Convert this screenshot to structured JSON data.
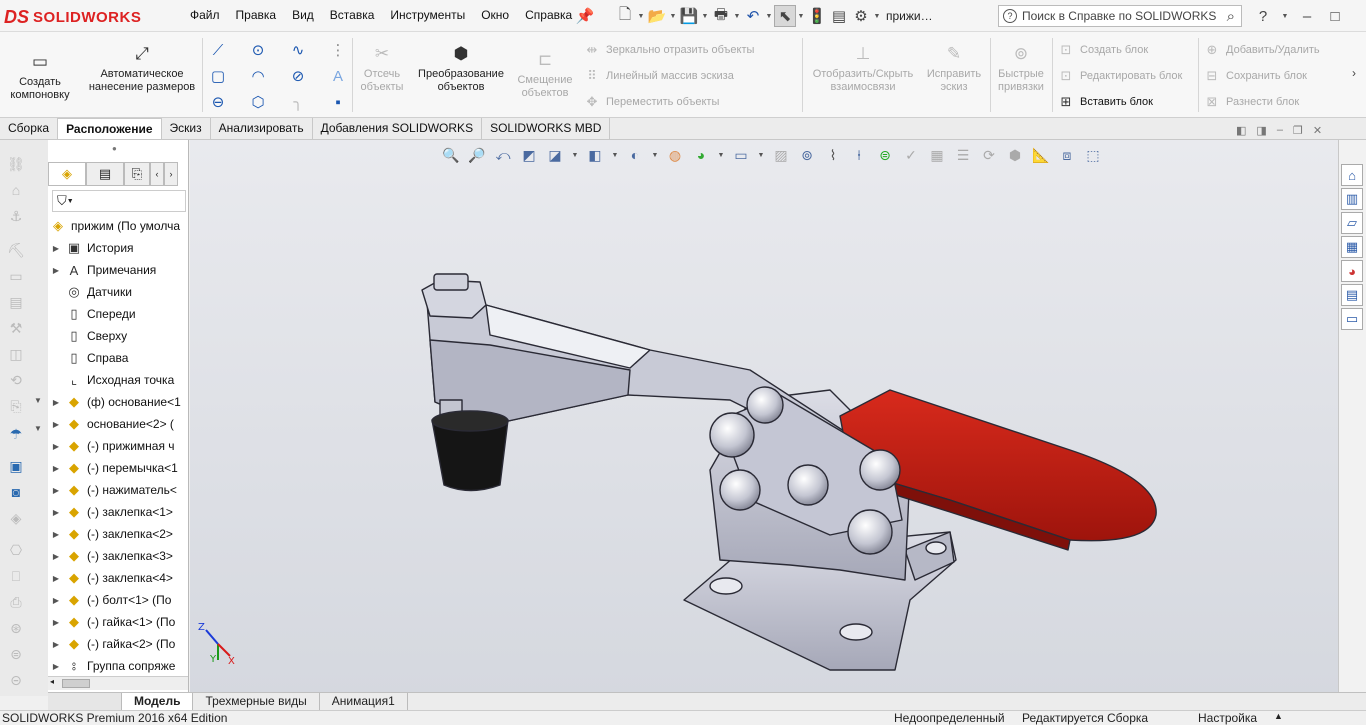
{
  "app": {
    "logo_ds": "DS",
    "logo_text": "SOLIDWORKS",
    "doc_name": "прижи…",
    "window_title_controls": [
      "?",
      "–",
      "□"
    ]
  },
  "menu": [
    "Файл",
    "Правка",
    "Вид",
    "Вставка",
    "Инструменты",
    "Окно",
    "Справка"
  ],
  "search": {
    "placeholder": "Поиск в Справке по SOLIDWORKS"
  },
  "ribbon": {
    "create_layout": "Создать компоновку",
    "auto_dim": "Автоматическое нанесение размеров",
    "trim": "Отсечь объекты",
    "convert": "Преобразование объектов",
    "offset": "Смещение объектов",
    "mirror": "Зеркально отразить объекты",
    "linear_pattern": "Линейный массив эскиза",
    "move": "Переместить объекты",
    "show_hide_rel": "Отобразить/Скрыть взаимосвязи",
    "repair": "Исправить эскиз",
    "quick_snaps": "Быстрые привязки",
    "create_block": "Создать блок",
    "edit_block": "Редактировать блок",
    "insert_block": "Вставить блок",
    "add_remove": "Добавить/Удалить",
    "save_block": "Сохранить блок",
    "explode_block": "Разнести блок"
  },
  "tabs": [
    "Сборка",
    "Расположение",
    "Эскиз",
    "Анализировать",
    "Добавления SOLIDWORKS",
    "SOLIDWORKS MBD"
  ],
  "active_tab": "Расположение",
  "tree": {
    "root": "прижим  (По умолча",
    "items": [
      {
        "label": "История",
        "icon": "history-icon",
        "exp": true
      },
      {
        "label": "Примечания",
        "icon": "annotations-icon",
        "exp": true
      },
      {
        "label": "Датчики",
        "icon": "sensors-icon",
        "exp": false
      },
      {
        "label": "Спереди",
        "icon": "plane-icon",
        "exp": false
      },
      {
        "label": "Сверху",
        "icon": "plane-icon",
        "exp": false
      },
      {
        "label": "Справа",
        "icon": "plane-icon",
        "exp": false
      },
      {
        "label": "Исходная точка",
        "icon": "origin-icon",
        "exp": false
      },
      {
        "label": "(ф) основание<1",
        "icon": "part-icon",
        "exp": true
      },
      {
        "label": "основание<2> (",
        "icon": "part-icon",
        "exp": true
      },
      {
        "label": "(-) прижимная ч",
        "icon": "part-icon",
        "exp": true
      },
      {
        "label": "(-) перемычка<1",
        "icon": "part-icon",
        "exp": true
      },
      {
        "label": "(-) нажиматель<",
        "icon": "part-icon",
        "exp": true
      },
      {
        "label": "(-) заклепка<1>",
        "icon": "part-icon",
        "exp": true
      },
      {
        "label": "(-) заклепка<2>",
        "icon": "part-icon",
        "exp": true
      },
      {
        "label": "(-) заклепка<3>",
        "icon": "part-icon",
        "exp": true
      },
      {
        "label": "(-) заклепка<4>",
        "icon": "part-icon",
        "exp": true
      },
      {
        "label": "(-) болт<1> (По",
        "icon": "part-icon",
        "exp": true
      },
      {
        "label": "(-) гайка<1> (По",
        "icon": "part-icon",
        "exp": true
      },
      {
        "label": "(-) гайка<2> (По",
        "icon": "part-icon",
        "exp": true
      },
      {
        "label": "Группа сопряже",
        "icon": "mates-icon",
        "exp": true
      }
    ]
  },
  "triad": {
    "x": "X",
    "y": "Y",
    "z": "Z"
  },
  "bottom_tabs": [
    "Модель",
    "Трехмерные виды",
    "Анимация1"
  ],
  "status": {
    "edition": "SOLIDWORKS Premium 2016 x64 Edition",
    "defined": "Недоопределенный",
    "editing": "Редактируется Сборка",
    "custom": "Настройка"
  },
  "colors": {
    "handle": "#c41a12",
    "metal": "#c8cad6",
    "rubber": "#1a1a1a"
  }
}
